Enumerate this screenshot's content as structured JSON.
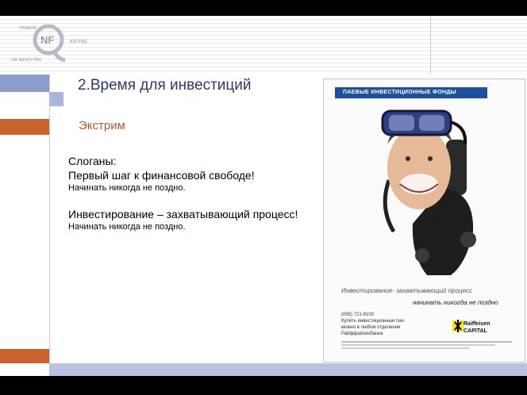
{
  "logo": {
    "word_top": "Новый",
    "word_right": "взгляд",
    "word_bottom": "на качество",
    "mark_letters": "NFQ"
  },
  "slide": {
    "title": "2.Время для инвестиций",
    "subtitle": "Экстрим",
    "slogans_heading": "Слоганы:",
    "slogan1": "Первый шаг к финансовой свободе!",
    "slogan1_sub": "Начинать никогда не поздно.",
    "slogan2": "Инвестирование – захватывающий процесс!",
    "slogan2_sub": "Начинать никогда не поздно."
  },
  "ad": {
    "header": "ПАЕВЫЕ ИНВЕСТИЦИОННЫЕ ФОНДЫ",
    "tagline": "Инвестирование- захватывающий процесс",
    "tagline2": "начинать никогда не поздно",
    "phone": "(095) 721-9100",
    "phone_note": "Купить инвестиционные паи можно в любом отделении Райффайзенбанка",
    "brand_line1": "Raiffeisen",
    "brand_line2": "CAPITAL"
  },
  "colors": {
    "accent_orange": "#c9632b",
    "accent_blue": "#8d9ccc",
    "title_navy": "#2c3a67",
    "subtitle_orange": "#b05a2a"
  }
}
